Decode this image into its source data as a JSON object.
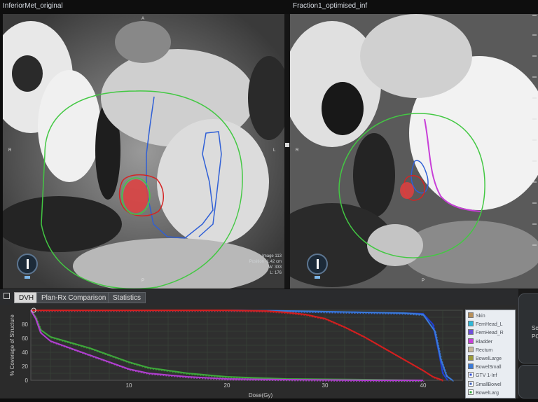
{
  "left_viewer": {
    "title": "InferiorMet_original",
    "orient": {
      "top": "A",
      "left": "R",
      "right": "L",
      "bottom": "P"
    },
    "info": [
      "Image 113",
      "Position -1.42 cm",
      "W: 333",
      "L: 176"
    ]
  },
  "right_viewer": {
    "title": "Fraction1_optimised_inf",
    "orient": {
      "left": "R",
      "bottom": "P"
    }
  },
  "tabs": [
    {
      "label": "DVH"
    },
    {
      "label": "Plan-Rx Comparison"
    },
    {
      "label": "Statistics"
    }
  ],
  "right_panel": {
    "line1": "Sc",
    "line2": "PC"
  },
  "chart_data": {
    "type": "line",
    "title": "",
    "xlabel": "Dose(Gy)",
    "ylabel": "% Coverage of Structure",
    "xlim": [
      0,
      44
    ],
    "ylim": [
      0,
      100
    ],
    "xticks": [
      10,
      20,
      30,
      40
    ],
    "yticks": [
      0,
      20,
      40,
      60,
      80
    ],
    "grid": true,
    "legend_position": "right",
    "series": [
      {
        "name": "GTV 1-Inf",
        "color": "#1f3fd6",
        "x": [
          0,
          10,
          20,
          26,
          30,
          34,
          38,
          40,
          41,
          41.6,
          42,
          42.5
        ],
        "y": [
          100,
          100,
          100,
          99,
          98,
          97,
          96,
          95,
          80,
          40,
          10,
          0
        ]
      },
      {
        "name": "BowelSmall",
        "color": "#3a7ad8",
        "x": [
          0,
          10,
          20,
          26,
          30,
          34,
          38,
          40,
          41.2,
          41.8,
          42.4,
          43
        ],
        "y": [
          100,
          100,
          100,
          99,
          98,
          97,
          96,
          94,
          70,
          30,
          6,
          0
        ]
      },
      {
        "name": "Rectum",
        "color": "#d41f1f",
        "x": [
          0,
          10,
          20,
          24,
          26,
          28,
          30,
          32,
          34,
          36,
          38,
          39,
          40,
          41,
          42
        ],
        "y": [
          100,
          100,
          100,
          99,
          97,
          94,
          88,
          76,
          62,
          46,
          30,
          22,
          14,
          5,
          0
        ]
      },
      {
        "name": "BowelLarge",
        "color": "#3ea83a",
        "x": [
          0,
          0.5,
          1,
          2,
          4,
          6,
          8,
          10,
          12,
          16,
          20,
          26,
          34,
          40
        ],
        "y": [
          100,
          90,
          72,
          62,
          54,
          46,
          36,
          26,
          18,
          10,
          5,
          2,
          1,
          0
        ]
      },
      {
        "name": "Bladder",
        "color": "#b03fcf",
        "x": [
          0,
          0.5,
          1,
          2,
          4,
          6,
          8,
          10,
          12,
          16,
          20,
          26,
          34,
          40
        ],
        "y": [
          100,
          88,
          68,
          56,
          46,
          36,
          26,
          16,
          10,
          5,
          2,
          1,
          0,
          0
        ]
      }
    ]
  },
  "legend": [
    {
      "label": "Skin",
      "color": "#b8905a",
      "checked": false
    },
    {
      "label": "FemHead_L",
      "color": "#2fb8d8",
      "checked": false
    },
    {
      "label": "FemHead_R",
      "color": "#6e4fd8",
      "checked": false
    },
    {
      "label": "Bladder",
      "color": "#c83fd8",
      "checked": false
    },
    {
      "label": "Rectum",
      "color": "#c8b89a",
      "checked": false
    },
    {
      "label": "BowelLarge",
      "color": "#9a9a3a",
      "checked": false
    },
    {
      "label": "BowelSmall",
      "color": "#3a7ad8",
      "checked": false
    },
    {
      "label": "GTV 1-Inf",
      "color": "#2f4fd8",
      "checked": true
    },
    {
      "label": "SmallBowel",
      "color": "#3a5fb8",
      "checked": true
    },
    {
      "label": "BowelLarg",
      "color": "#2fa83a",
      "checked": true
    }
  ]
}
